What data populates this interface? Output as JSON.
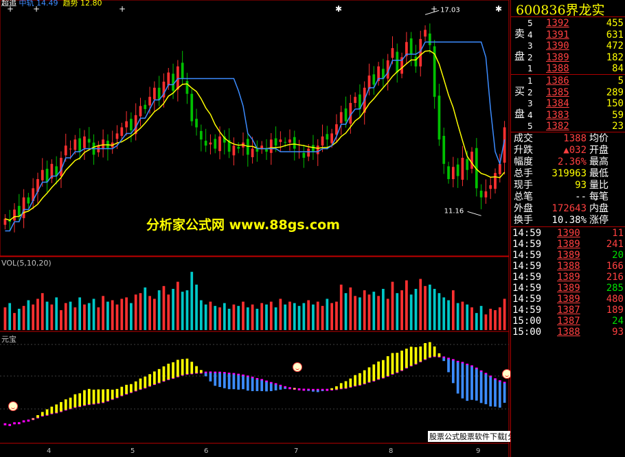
{
  "header": {
    "name1": "超追",
    "name2": "中轨",
    "val2": "14.49",
    "name3": "趋势",
    "val3": "12.80"
  },
  "volume_label": "VOL(5,10,20)",
  "indicator_label": "元宝",
  "watermark": "分析家公式网 www.88gs.com",
  "footer": "股票公式股票软件下载[分析家公式网www.88gs.com]",
  "colors": {
    "up": "#ff3030",
    "down": "#00c000",
    "vol_down": "#00c8c8",
    "ma_yellow": "#ffff00",
    "ma_blue": "#3c8cff",
    "magenta": "#ff00ff",
    "bg": "#000000",
    "border": "#c00000"
  },
  "quote": {
    "code": "600836",
    "name": "界龙实",
    "sell_label": [
      "卖",
      "盘"
    ],
    "buy_label": [
      "买",
      "盘"
    ],
    "sell": [
      {
        "level": "5",
        "price": "1392",
        "vol": "455"
      },
      {
        "level": "4",
        "price": "1391",
        "vol": "631"
      },
      {
        "level": "3",
        "price": "1390",
        "vol": "472"
      },
      {
        "level": "2",
        "price": "1389",
        "vol": "182"
      },
      {
        "level": "1",
        "price": "1388",
        "vol": "84"
      }
    ],
    "buy": [
      {
        "level": "1",
        "price": "1386",
        "vol": "5"
      },
      {
        "level": "2",
        "price": "1385",
        "vol": "289"
      },
      {
        "level": "3",
        "price": "1384",
        "vol": "150"
      },
      {
        "level": "4",
        "price": "1383",
        "vol": "59"
      },
      {
        "level": "5",
        "price": "1382",
        "vol": "23"
      }
    ],
    "stats": [
      {
        "l": "成交",
        "v": "1388",
        "r": "均价"
      },
      {
        "l": "升跌",
        "v": "▲032",
        "r": "开盘"
      },
      {
        "l": "幅度",
        "v": "2.36%",
        "r": "最高"
      },
      {
        "l": "总手",
        "v": "319963",
        "r": "最低"
      },
      {
        "l": "现手",
        "v": "93",
        "r": "量比"
      },
      {
        "l": "总笔",
        "v": "--",
        "r": "每笔"
      },
      {
        "l": "外盘",
        "v": "172643",
        "r": "内盘"
      },
      {
        "l": "换手",
        "v": "10.38%",
        "r": "涨停"
      }
    ],
    "ticks": [
      {
        "t": "14:59",
        "p": "1390",
        "v": "11"
      },
      {
        "t": "14:59",
        "p": "1389",
        "v": "241"
      },
      {
        "t": "14:59",
        "p": "1389",
        "v": "20"
      },
      {
        "t": "14:59",
        "p": "1388",
        "v": "166"
      },
      {
        "t": "14:59",
        "p": "1389",
        "v": "216"
      },
      {
        "t": "14:59",
        "p": "1389",
        "v": "285"
      },
      {
        "t": "14:59",
        "p": "1389",
        "v": "480"
      },
      {
        "t": "14:59",
        "p": "1387",
        "v": "189"
      },
      {
        "t": "15:00",
        "p": "1387",
        "v": "24"
      },
      {
        "t": "15:00",
        "p": "1388",
        "v": "93"
      }
    ]
  },
  "chart_data": {
    "type": "candlestick",
    "price_range": [
      9.4,
      17.6
    ],
    "annotations": [
      {
        "text": "17.03",
        "kind": "high"
      },
      {
        "text": "11.16",
        "kind": "low"
      }
    ],
    "x_tick_labels": [
      "4",
      "5",
      "6",
      "7",
      "8",
      "9"
    ],
    "close": [
      10.6,
      10.5,
      10.9,
      10.7,
      11.3,
      11.1,
      11.6,
      11.9,
      12.2,
      11.8,
      12.4,
      12.0,
      12.6,
      13.0,
      12.9,
      13.2,
      12.8,
      13.3,
      13.1,
      12.7,
      13.0,
      13.2,
      12.9,
      13.1,
      13.4,
      13.6,
      13.8,
      13.5,
      14.0,
      14.3,
      14.2,
      14.6,
      14.9,
      14.5,
      15.1,
      15.4,
      14.8,
      15.6,
      15.2,
      14.7,
      13.8,
      13.6,
      13.2,
      13.0,
      13.1,
      12.9,
      13.3,
      13.1,
      12.8,
      13.0,
      12.9,
      13.1,
      12.7,
      12.9,
      12.8,
      13.0,
      12.8,
      13.2,
      13.0,
      13.2,
      13.1,
      13.2,
      12.9,
      12.8,
      12.6,
      12.9,
      12.8,
      13.0,
      13.3,
      13.2,
      13.4,
      13.7,
      14.1,
      13.8,
      14.4,
      14.6,
      14.2,
      14.9,
      15.3,
      15.0,
      15.6,
      15.2,
      15.8,
      16.2,
      15.4,
      15.9,
      16.4,
      16.0,
      15.6,
      16.5,
      16.8,
      16.3,
      14.6,
      13.2,
      12.4,
      11.9,
      12.3,
      12.0,
      12.6,
      12.2,
      12.8,
      11.6,
      11.3,
      11.5,
      11.7,
      12.1,
      12.4,
      13.6
    ],
    "volume": [
      1.6,
      1.9,
      1.2,
      1.5,
      1.7,
      2.1,
      1.8,
      2.2,
      2.6,
      2.0,
      1.8,
      2.3,
      1.4,
      1.9,
      2.0,
      1.6,
      2.3,
      1.8,
      1.9,
      2.2,
      1.6,
      2.4,
      2.0,
      2.1,
      1.8,
      2.2,
      2.3,
      1.9,
      2.5,
      2.6,
      3.0,
      2.4,
      2.2,
      2.8,
      3.1,
      2.5,
      2.9,
      3.4,
      2.7,
      2.8,
      4.1,
      3.2,
      2.1,
      1.8,
      2.0,
      1.7,
      1.6,
      1.9,
      1.5,
      1.8,
      1.7,
      2.0,
      1.6,
      1.8,
      1.5,
      1.9,
      1.8,
      2.0,
      1.6,
      2.2,
      1.8,
      2.0,
      1.9,
      1.7,
      1.9,
      2.1,
      1.8,
      2.0,
      1.7,
      2.2,
      1.9,
      2.0,
      3.2,
      2.6,
      3.0,
      2.4,
      2.3,
      2.8,
      2.5,
      2.7,
      2.4,
      2.9,
      2.2,
      3.4,
      2.6,
      2.8,
      3.5,
      2.5,
      2.9,
      3.6,
      3.1,
      3.2,
      2.9,
      2.6,
      2.3,
      2.1,
      2.8,
      1.9,
      2.0,
      1.8,
      1.6,
      1.2,
      1.7,
      1.1,
      1.5,
      1.4,
      1.6,
      2.2
    ]
  }
}
